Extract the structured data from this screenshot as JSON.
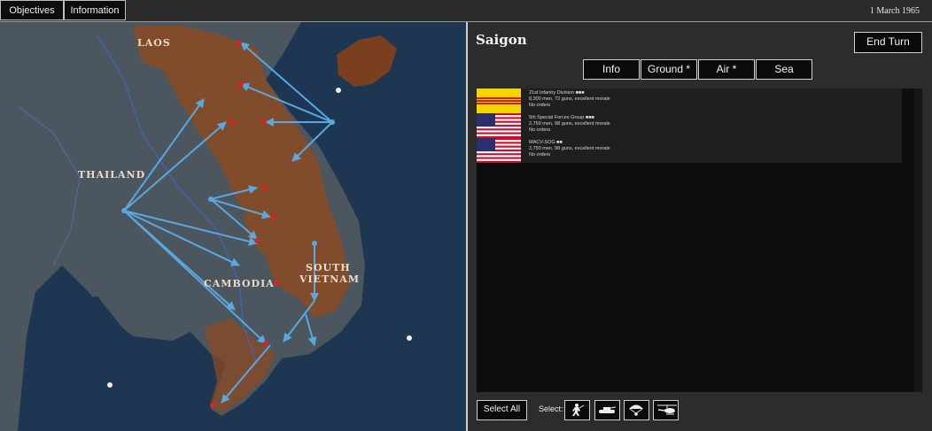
{
  "topbar": {
    "objectives_label": "Objectives",
    "information_label": "Information",
    "date": "1 March 1965"
  },
  "map": {
    "labels": {
      "laos": "LAOS",
      "thailand": "THAILAND",
      "cambodia": "CAMBODIA",
      "south": "SOUTH",
      "vietnam": "VIETNAM"
    }
  },
  "panel": {
    "city": "Saigon",
    "end_turn_label": "End Turn",
    "tabs": [
      {
        "label": "Info"
      },
      {
        "label": "Ground *"
      },
      {
        "label": "Air *"
      },
      {
        "label": "Sea"
      }
    ],
    "units": [
      {
        "flag": "south-vietnam-flag",
        "name": "21st Infantry Division ■■■",
        "stats": "8,300 men, 72 guns, excellent morale",
        "orders": "No orders"
      },
      {
        "flag": "us-flag",
        "name": "5th Special Forces Group ■■■",
        "stats": "2,750 men, 98 guns, excellent morale",
        "orders": "No orders"
      },
      {
        "flag": "us-flag",
        "name": "MACV-SOG ■■",
        "stats": "2,750 men, 98 guns, excellent morale",
        "orders": "No orders"
      }
    ],
    "select_all_label": "Select All",
    "select_label": "Select:",
    "select_icons": [
      "infantry-icon",
      "tank-icon",
      "paratrooper-icon",
      "helicopter-icon"
    ]
  },
  "colors": {
    "sea": "#1c3550",
    "land": "#4a5560",
    "controlled_territory": "#8a4a22",
    "movement_arrow": "#5aa8e0",
    "sv_flag_yellow": "#f5d400",
    "sv_flag_red": "#d21f1f"
  }
}
